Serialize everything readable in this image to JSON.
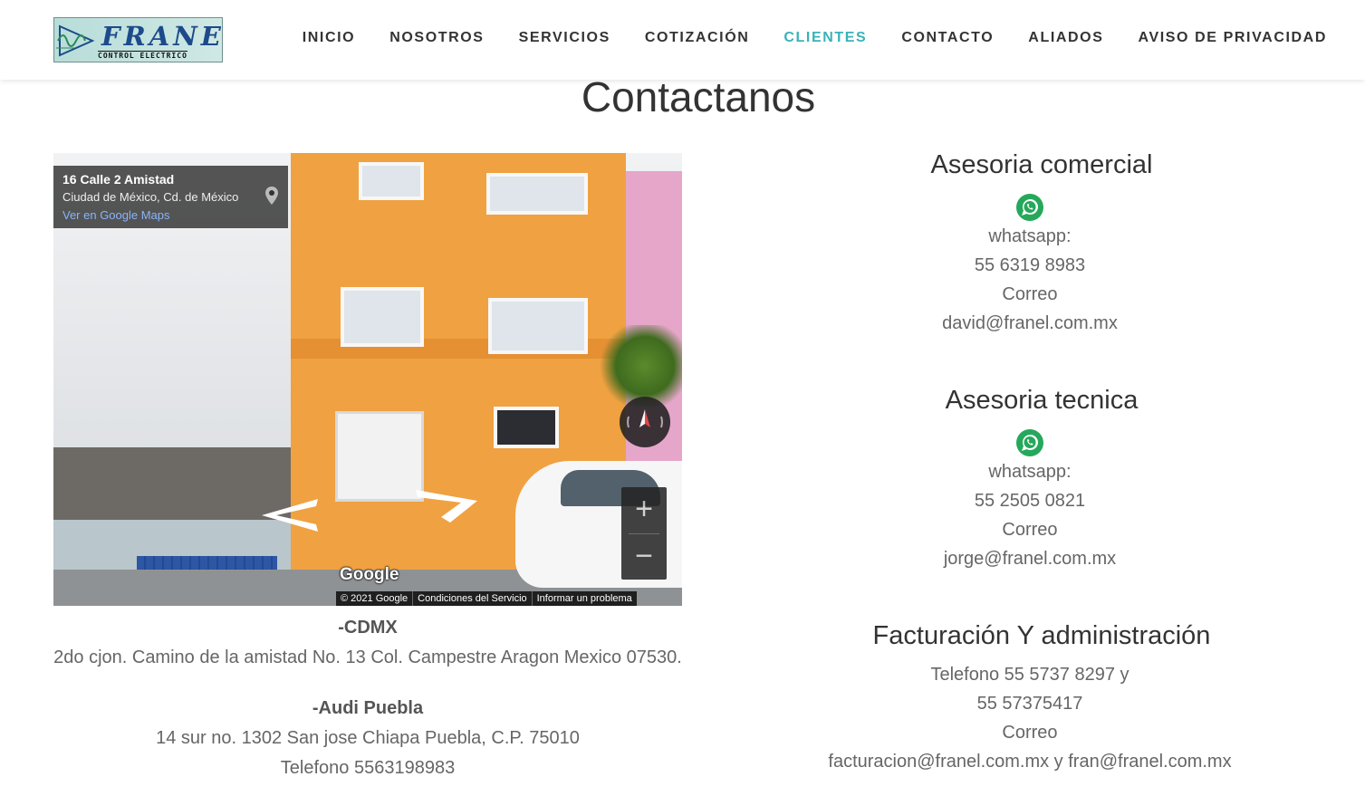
{
  "header": {
    "logo": {
      "text": "FRANEL",
      "subtext": "CONTROL ELECTRICO"
    },
    "nav": [
      {
        "label": "INICIO",
        "active": false
      },
      {
        "label": "NOSOTROS",
        "active": false
      },
      {
        "label": "SERVICIOS",
        "active": false
      },
      {
        "label": "COTIZACIÓN",
        "active": false
      },
      {
        "label": "CLIENTES",
        "active": true
      },
      {
        "label": "CONTACTO",
        "active": false
      },
      {
        "label": "ALIADOS",
        "active": false
      },
      {
        "label": "AVISO DE PRIVACIDAD",
        "active": false
      }
    ],
    "accent_color": "#3bb2b8"
  },
  "page_title": "Contactanos",
  "streetview": {
    "place_title": "16 Calle 2 Amistad",
    "place_address": "Ciudad de México, Cd. de México",
    "map_link": "Ver en Google Maps",
    "google_logo": "Google",
    "footer": [
      "© 2021 Google",
      "Condiciones del Servicio",
      "Informar un problema"
    ],
    "zoom_in": "+",
    "zoom_out": "−"
  },
  "locations": [
    {
      "heading": "-CDMX",
      "lines": [
        "2do cjon. Camino de la amistad No. 13 Col. Campestre Aragon Mexico 07530."
      ]
    },
    {
      "heading": "-Audi Puebla",
      "lines": [
        "14 sur no. 1302 San jose Chiapa Puebla, C.P. 75010",
        "Telefono 5563198983"
      ]
    }
  ],
  "contacts": {
    "comercial": {
      "heading": "Asesoria comercial",
      "icon": "whatsapp-icon",
      "lines": [
        "whatsapp:",
        "55 6319 8983",
        "Correo",
        "david@franel.com.mx"
      ]
    },
    "tecnica": {
      "heading": "Asesoria tecnica",
      "icon": "whatsapp-icon",
      "lines": [
        "whatsapp:",
        "55 2505 0821",
        "Correo",
        "jorge@franel.com.mx"
      ]
    },
    "facturacion": {
      "heading": "Facturación Y administración",
      "lines": [
        "Telefono 55 5737 8297 y",
        "55 57375417",
        "Correo",
        "facturacion@franel.com.mx y fran@franel.com.mx"
      ]
    }
  }
}
